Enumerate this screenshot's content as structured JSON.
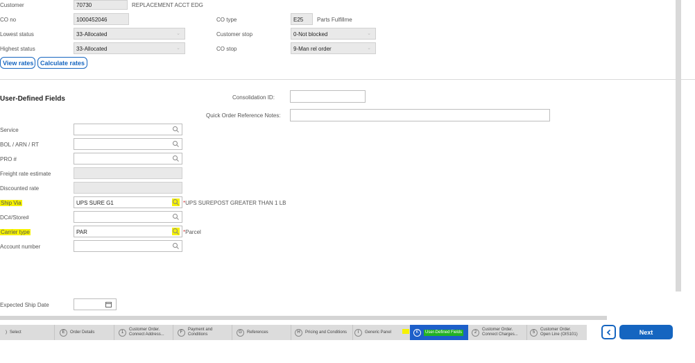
{
  "header": {
    "customer_label": "Customer",
    "customer_value": "70730",
    "customer_name": "REPLACEMENT ACCT EDG",
    "co_no_label": "CO no",
    "co_no_value": "1000452046",
    "co_type_label": "CO type",
    "co_type_value": "E25",
    "co_type_desc": "Parts Fulfillme",
    "lowest_status_label": "Lowest status",
    "lowest_status_value": "33-Allocated",
    "customer_stop_label": "Customer stop",
    "customer_stop_value": "0-Not blocked",
    "highest_status_label": "Highest status",
    "highest_status_value": "33-Allocated",
    "co_stop_label": "CO stop",
    "co_stop_value": "9-Man rel order",
    "view_rates_label": "View rates",
    "calculate_rates_label": "Calculate rates"
  },
  "udf": {
    "title": "User-Defined Fields",
    "consolidation_id_label": "Consolidation ID:",
    "consolidation_id_value": "",
    "quick_notes_label": "Quick Order Reference Notes:",
    "quick_notes_value": "",
    "service_label": "Service",
    "service_value": "",
    "bol_label": "BOL / ARN / RT",
    "bol_value": "",
    "pro_label": "PRO #",
    "pro_value": "",
    "freight_label": "Freight rate estimate",
    "discounted_label": "Discounted rate",
    "ship_via_label": "Ship Via",
    "ship_via_value": "UPS SURE G1",
    "ship_via_desc": "UPS SUREPOST GREATER THAN 1 LB",
    "dc_store_label": "DC#/Store#",
    "dc_store_value": "",
    "carrier_type_label": "Carrier type",
    "carrier_type_value": "PAR",
    "carrier_type_desc": "Parcel",
    "account_label": "Account number",
    "account_value": "",
    "expected_ship_label": "Expected Ship Date",
    "expected_ship_value": ""
  },
  "steps": [
    {
      "key": "",
      "label": "Select"
    },
    {
      "key": "E",
      "label": "Order Details"
    },
    {
      "key": "1",
      "label": "Customer Order. Connect Address..."
    },
    {
      "key": "F",
      "label": "Payment and Conditions"
    },
    {
      "key": "G",
      "label": "References"
    },
    {
      "key": "H",
      "label": "Pricing and Conditions"
    },
    {
      "key": "I",
      "label": "Generic Panel"
    },
    {
      "key": "K",
      "label": "User-Defined Fields"
    },
    {
      "key": "2",
      "label": "Customer Order. Connect Charges..."
    },
    {
      "key": "5",
      "label": "Customer Order. Open Line (OIS101)"
    }
  ],
  "nav": {
    "next_label": "Next"
  },
  "colors": {
    "accent": "#1565c0",
    "highlight": "#f6f200",
    "active_step": "#1d5fc9",
    "active_step_highlight": "#23b223"
  },
  "icons": {
    "search": "search-icon",
    "calendar": "calendar-icon",
    "back": "chevron-left-icon",
    "dropdown": "chevron-down-icon"
  }
}
